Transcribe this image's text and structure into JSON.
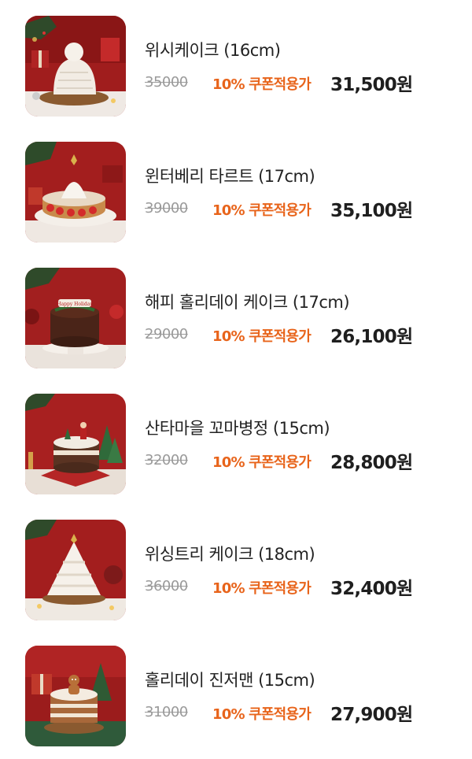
{
  "products": [
    {
      "name": "위시케이크 (16cm)",
      "original_price": "35000",
      "coupon": "10% 쿠폰적용가",
      "final_price": "31,500원"
    },
    {
      "name": "윈터베리 타르트 (17cm)",
      "original_price": "39000",
      "coupon": "10% 쿠폰적용가",
      "final_price": "35,100원"
    },
    {
      "name": "해피 홀리데이 케이크 (17cm)",
      "original_price": "29000",
      "coupon": "10% 쿠폰적용가",
      "final_price": "26,100원",
      "image_text": "Happy Holiday"
    },
    {
      "name": "산타마을 꼬마병정 (15cm)",
      "original_price": "32000",
      "coupon": "10% 쿠폰적용가",
      "final_price": "28,800원"
    },
    {
      "name": "위싱트리 케이크 (18cm)",
      "original_price": "36000",
      "coupon": "10% 쿠폰적용가",
      "final_price": "32,400원"
    },
    {
      "name": "홀리데이 진저맨 (15cm)",
      "original_price": "31000",
      "coupon": "10% 쿠폰적용가",
      "final_price": "27,900원"
    }
  ],
  "colors": {
    "coupon": "#e8641b",
    "price": "#1f1f1f",
    "strike": "#9a9a9a",
    "background_red": "#9e1c1c"
  }
}
